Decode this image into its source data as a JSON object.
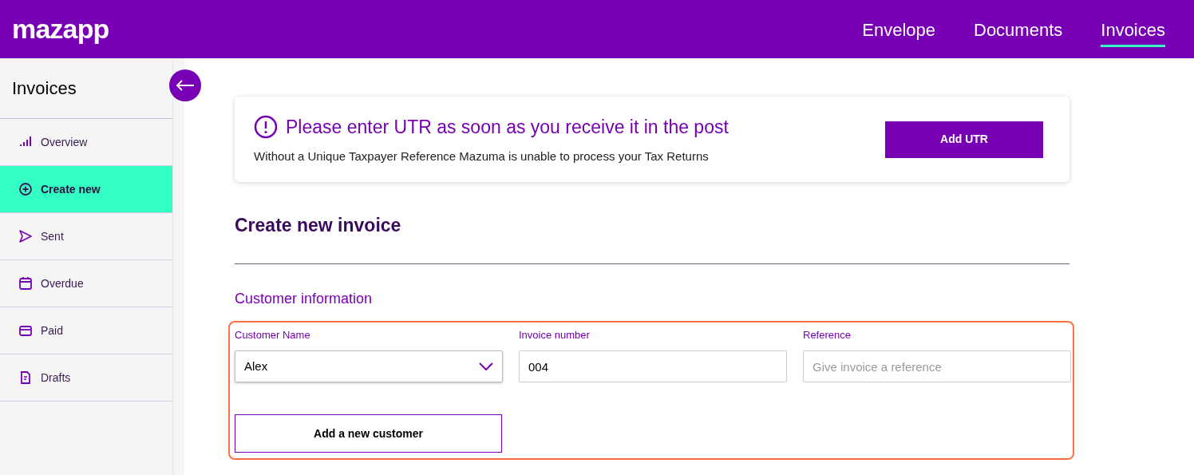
{
  "header": {
    "logo": "mazapp",
    "nav": [
      {
        "label": "Envelope",
        "selected": false
      },
      {
        "label": "Documents",
        "selected": false
      },
      {
        "label": "Invoices",
        "selected": true
      }
    ]
  },
  "sidebar": {
    "title": "Invoices",
    "items": [
      {
        "label": "Overview",
        "selected": false
      },
      {
        "label": "Create new",
        "selected": true
      },
      {
        "label": "Sent",
        "selected": false
      },
      {
        "label": "Overdue",
        "selected": false
      },
      {
        "label": "Paid",
        "selected": false
      },
      {
        "label": "Drafts",
        "selected": false
      }
    ]
  },
  "alert": {
    "title": "Please enter UTR as soon as you receive it in the post",
    "text": "Without a Unique Taxpayer Reference Mazuma is unable to process your Tax Returns",
    "button": "Add UTR"
  },
  "page_title": "Create new invoice",
  "section_title": "Customer information",
  "fields": [
    {
      "kind": "select",
      "label": "Customer Name",
      "value": "Alex"
    },
    {
      "kind": "input",
      "label": "Invoice number",
      "value": "004"
    },
    {
      "kind": "input",
      "label": "Reference",
      "placeholder": "Give invoice a reference"
    }
  ],
  "add_customer_button": "Add a new customer"
}
